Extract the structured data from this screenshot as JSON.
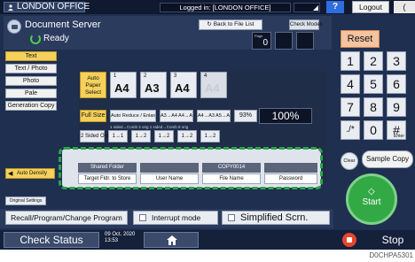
{
  "topbar": {
    "title": "LONDON OFFICE",
    "login_status": "Logged in: [LONDON OFFICE]",
    "help": "?",
    "logout": "Logout",
    "extra": "("
  },
  "header": {
    "app_title": "Document Server",
    "status": "Ready",
    "back_button": "Back to File List",
    "check_modes": "Check Modes",
    "pages_label": "Page",
    "pages_value": "0"
  },
  "left_modes": [
    "Text",
    "Text / Photo",
    "Photo",
    "Pale",
    "Generation Copy"
  ],
  "left_modes_selected": 0,
  "paper": {
    "auto_select": "Auto Paper Select",
    "trays": [
      {
        "num": "1",
        "size": "A4"
      },
      {
        "num": "2",
        "size": "A3"
      },
      {
        "num": "3",
        "size": "A4"
      },
      {
        "num": "4",
        "size": "A4"
      }
    ]
  },
  "zoom": {
    "full_size": "Full Size",
    "auto_reduce": "Auto Reduce / Enlarge",
    "opt1": "A3→A4 A4→A5",
    "opt2": "A4→A3 A5→A4",
    "small_pct": "93%",
    "big_pct": "100%"
  },
  "duplex": {
    "hint": "1 sided→Comb 2 orig 1 sided→Comb 8 orig",
    "label": "2 Sided Orig",
    "options": [
      "1→1",
      "1→2",
      "1→2",
      "1→2",
      "1→2"
    ]
  },
  "destination": {
    "columns": [
      {
        "top": "Shared Folder",
        "bottom": "Target Fldr. to Store"
      },
      {
        "top": "",
        "bottom": "User Name"
      },
      {
        "top": "COPY0014",
        "bottom": "File Name"
      },
      {
        "top": "",
        "bottom": "Password"
      }
    ]
  },
  "density": {
    "label": "Auto Density"
  },
  "original_settings": "Original Settings",
  "keypad": {
    "reset": "Reset",
    "keys": [
      "1",
      "2",
      "3",
      "4",
      "5",
      "6",
      "7",
      "8",
      "9",
      "./*",
      "0",
      "#"
    ],
    "enter_sub": "Enter",
    "clear": "Clear",
    "sample_copy": "Sample Copy",
    "start": "Start"
  },
  "bottom": {
    "recall": "Recall/Program/Change Program",
    "interrupt": "Interrupt mode",
    "simplified": "Simplified Scrn."
  },
  "status": {
    "check_status": "Check Status",
    "date_line1": "09 Oct. 2020",
    "date_line2": "13:53",
    "stop": "Stop"
  },
  "figure_id": "D0CHPA5301",
  "colors": {
    "accent_yellow": "#f5d15b",
    "start_green": "#33a946",
    "highlight_dashed_green": "#2aa64a",
    "stop_red": "#e8452e",
    "reset_orange": "#f4c3a0"
  }
}
